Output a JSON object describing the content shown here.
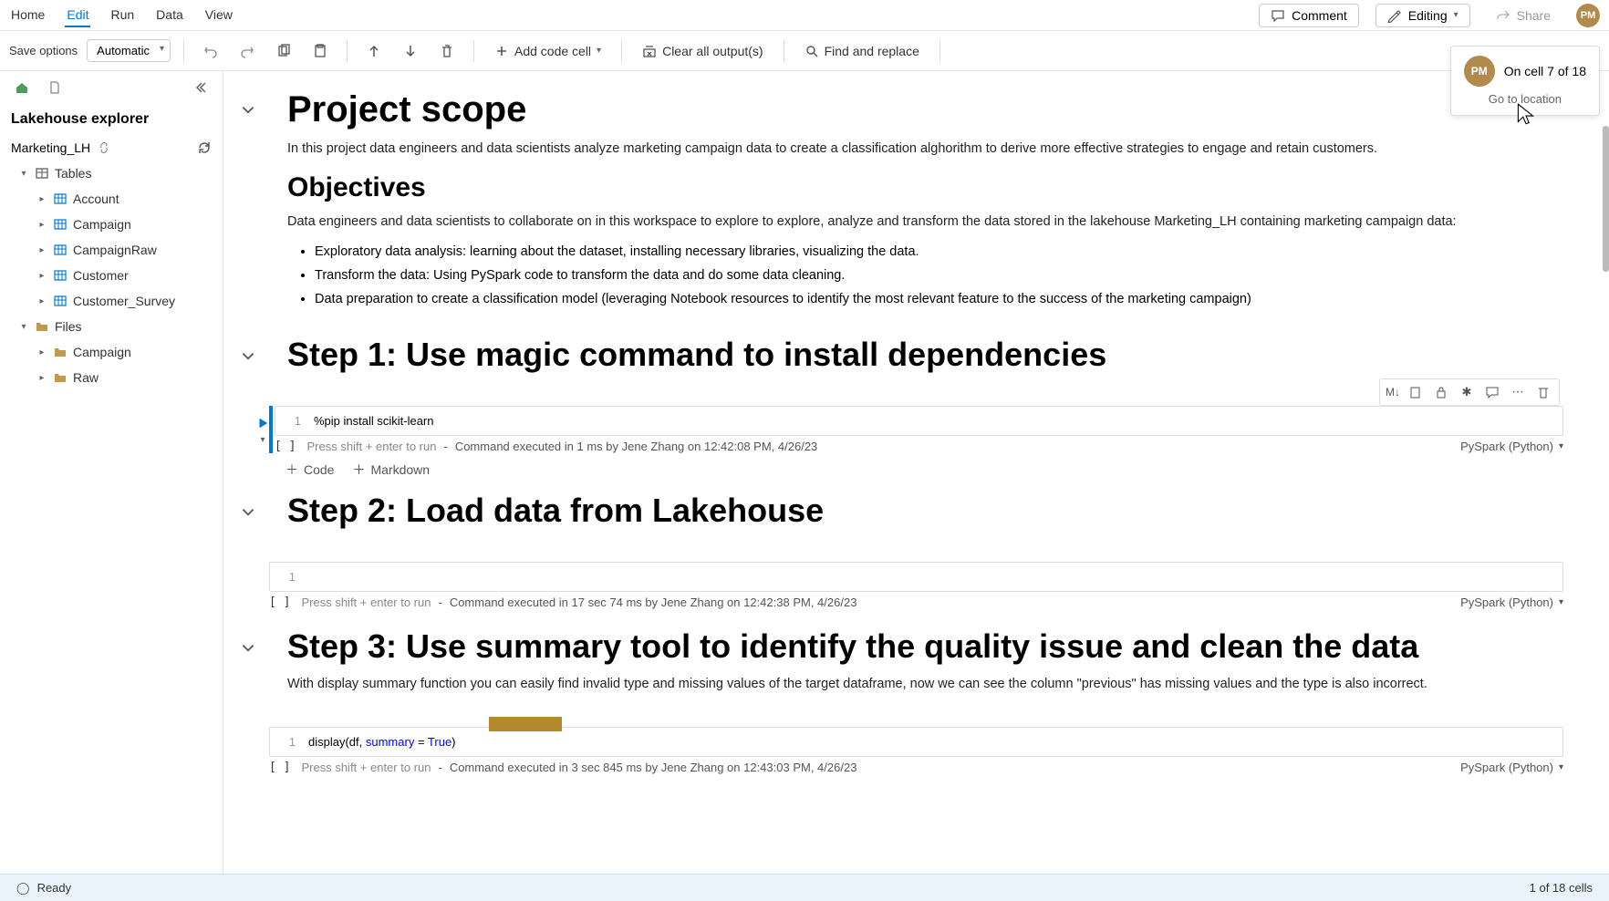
{
  "menu": {
    "home": "Home",
    "edit": "Edit",
    "run": "Run",
    "data": "Data",
    "view": "View"
  },
  "header": {
    "comment": "Comment",
    "editing": "Editing",
    "share": "Share",
    "avatar_initials": "PM"
  },
  "toolbar": {
    "save_options": "Save options",
    "save_mode": "Automatic",
    "add_code_cell": "Add code cell",
    "clear_outputs": "Clear all output(s)",
    "find_replace": "Find and replace"
  },
  "presence": {
    "initials": "PM",
    "status": "On cell 7 of 18",
    "goto": "Go to location"
  },
  "sidebar": {
    "title": "Lakehouse explorer",
    "lakehouse": "Marketing_LH",
    "tables_label": "Tables",
    "files_label": "Files",
    "tables": [
      "Account",
      "Campaign",
      "CampaignRaw",
      "Customer",
      "Customer_Survey"
    ],
    "files": [
      "Campaign",
      "Raw"
    ]
  },
  "doc": {
    "scope_h": "Project scope",
    "scope_p": "In this project data engineers and data scientists analyze marketing campaign data to create a classification alghorithm to derive more effective strategies to engage and retain customers.",
    "obj_h": "Objectives",
    "obj_p": "Data engineers and data scientists to collaborate on in this workspace to explore to explore, analyze and transform the data stored in the lakehouse Marketing_LH containing marketing campaign data:",
    "obj_li1": "Exploratory data analysis: learning about the dataset, installing necessary libraries, visualizing the data.",
    "obj_li2": "Transform the data: Using PySpark code to transform the data and do some data cleaning.",
    "obj_li3": "Data preparation to create a classification model (leveraging Notebook resources to identify the most relevant feature to the success of the marketing campaign)",
    "step1_h": "Step 1: Use magic command to install dependencies",
    "step2_h": "Step 2: Load data from Lakehouse",
    "step3_h": "Step 3: Use summary tool to identify the quality issue and clean the data",
    "step3_p": "With display summary function you can easily find invalid type and missing values of the target dataframe, now we can see the column \"previous\" has missing values and the type is also incorrect."
  },
  "cells": {
    "hint": "Press shift + enter to run",
    "lang": "PySpark (Python)",
    "add_code": "Code",
    "add_md": "Markdown",
    "ln": "1",
    "c1": {
      "code": "%pip install scikit-learn",
      "exec": "Command executed in 1 ms by Jene Zhang on 12:42:08 PM, 4/26/23"
    },
    "c2": {
      "code": "",
      "exec": "Command executed in 17 sec 74 ms by Jene Zhang on 12:42:38 PM, 4/26/23"
    },
    "c3": {
      "code_pre": "display(df, ",
      "code_kw": "summary",
      "code_eq": " = ",
      "code_val": "True",
      "code_end": ")",
      "exec": "Command executed in 3 sec 845 ms by Jene Zhang on 12:43:03 PM, 4/26/23"
    },
    "toolbar_m": "M↓",
    "bracket": "[ ]"
  },
  "status": {
    "ready": "Ready",
    "cells": "1 of 18 cells"
  }
}
